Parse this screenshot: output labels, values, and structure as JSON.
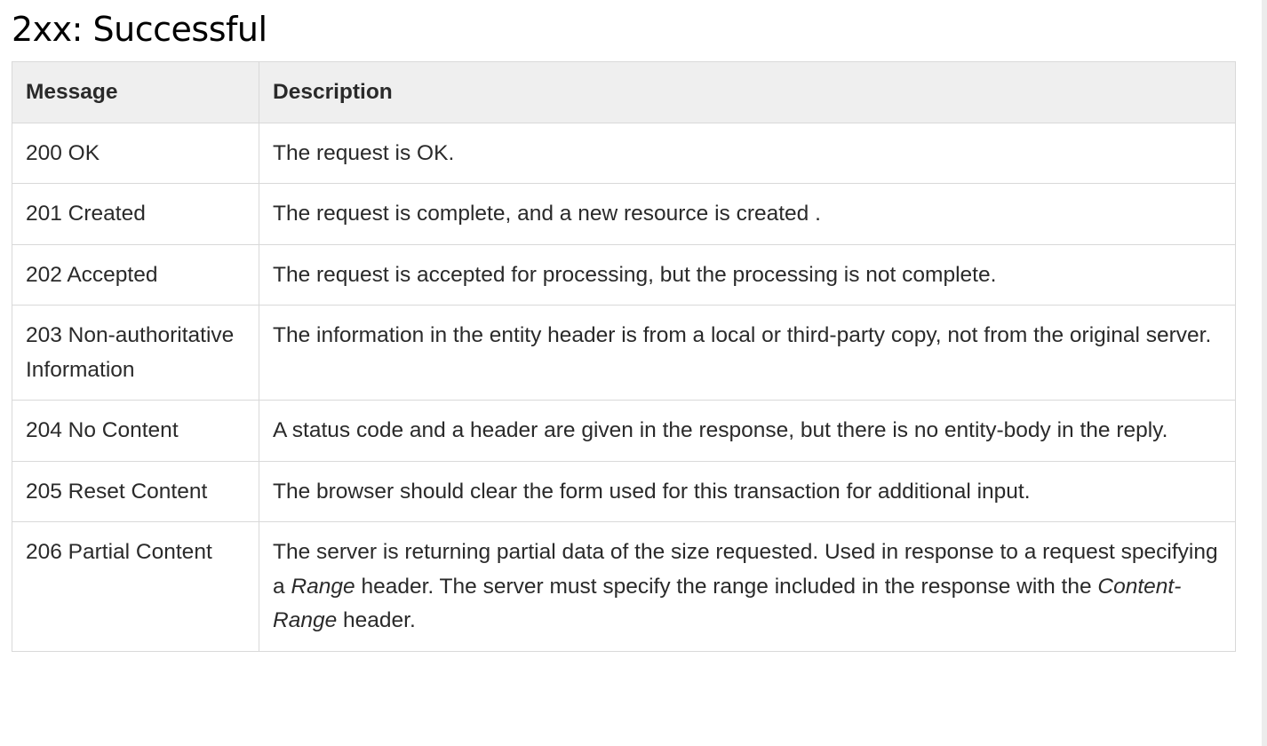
{
  "page": {
    "title": "2xx: Successful"
  },
  "table": {
    "columns": [
      "Message",
      "Description"
    ],
    "rows": [
      {
        "message": "200 OK",
        "description": "The request is OK."
      },
      {
        "message": "201 Created",
        "description": "The request is complete, and a new resource is created ."
      },
      {
        "message": "202 Accepted",
        "description": "The request is accepted for processing, but the processing is not complete."
      },
      {
        "message": "203 Non-authoritative Information",
        "description": "The information in the entity header is from a local or third-party copy, not from the original server."
      },
      {
        "message": "204 No Content",
        "description": "A status code and a header are given in the response, but there is no entity-body in the reply."
      },
      {
        "message": "205 Reset Content",
        "description": "The browser should clear the form used for this transaction for additional input."
      },
      {
        "message": "206 Partial Content",
        "description_parts": {
          "p1": "The server is returning partial data of the size requested. Used in response to a request specifying a ",
          "em1": "Range",
          "p2": " header. The server must specify the range included in the response with the ",
          "em2": "Content-Range",
          "p3": " header."
        }
      }
    ]
  }
}
